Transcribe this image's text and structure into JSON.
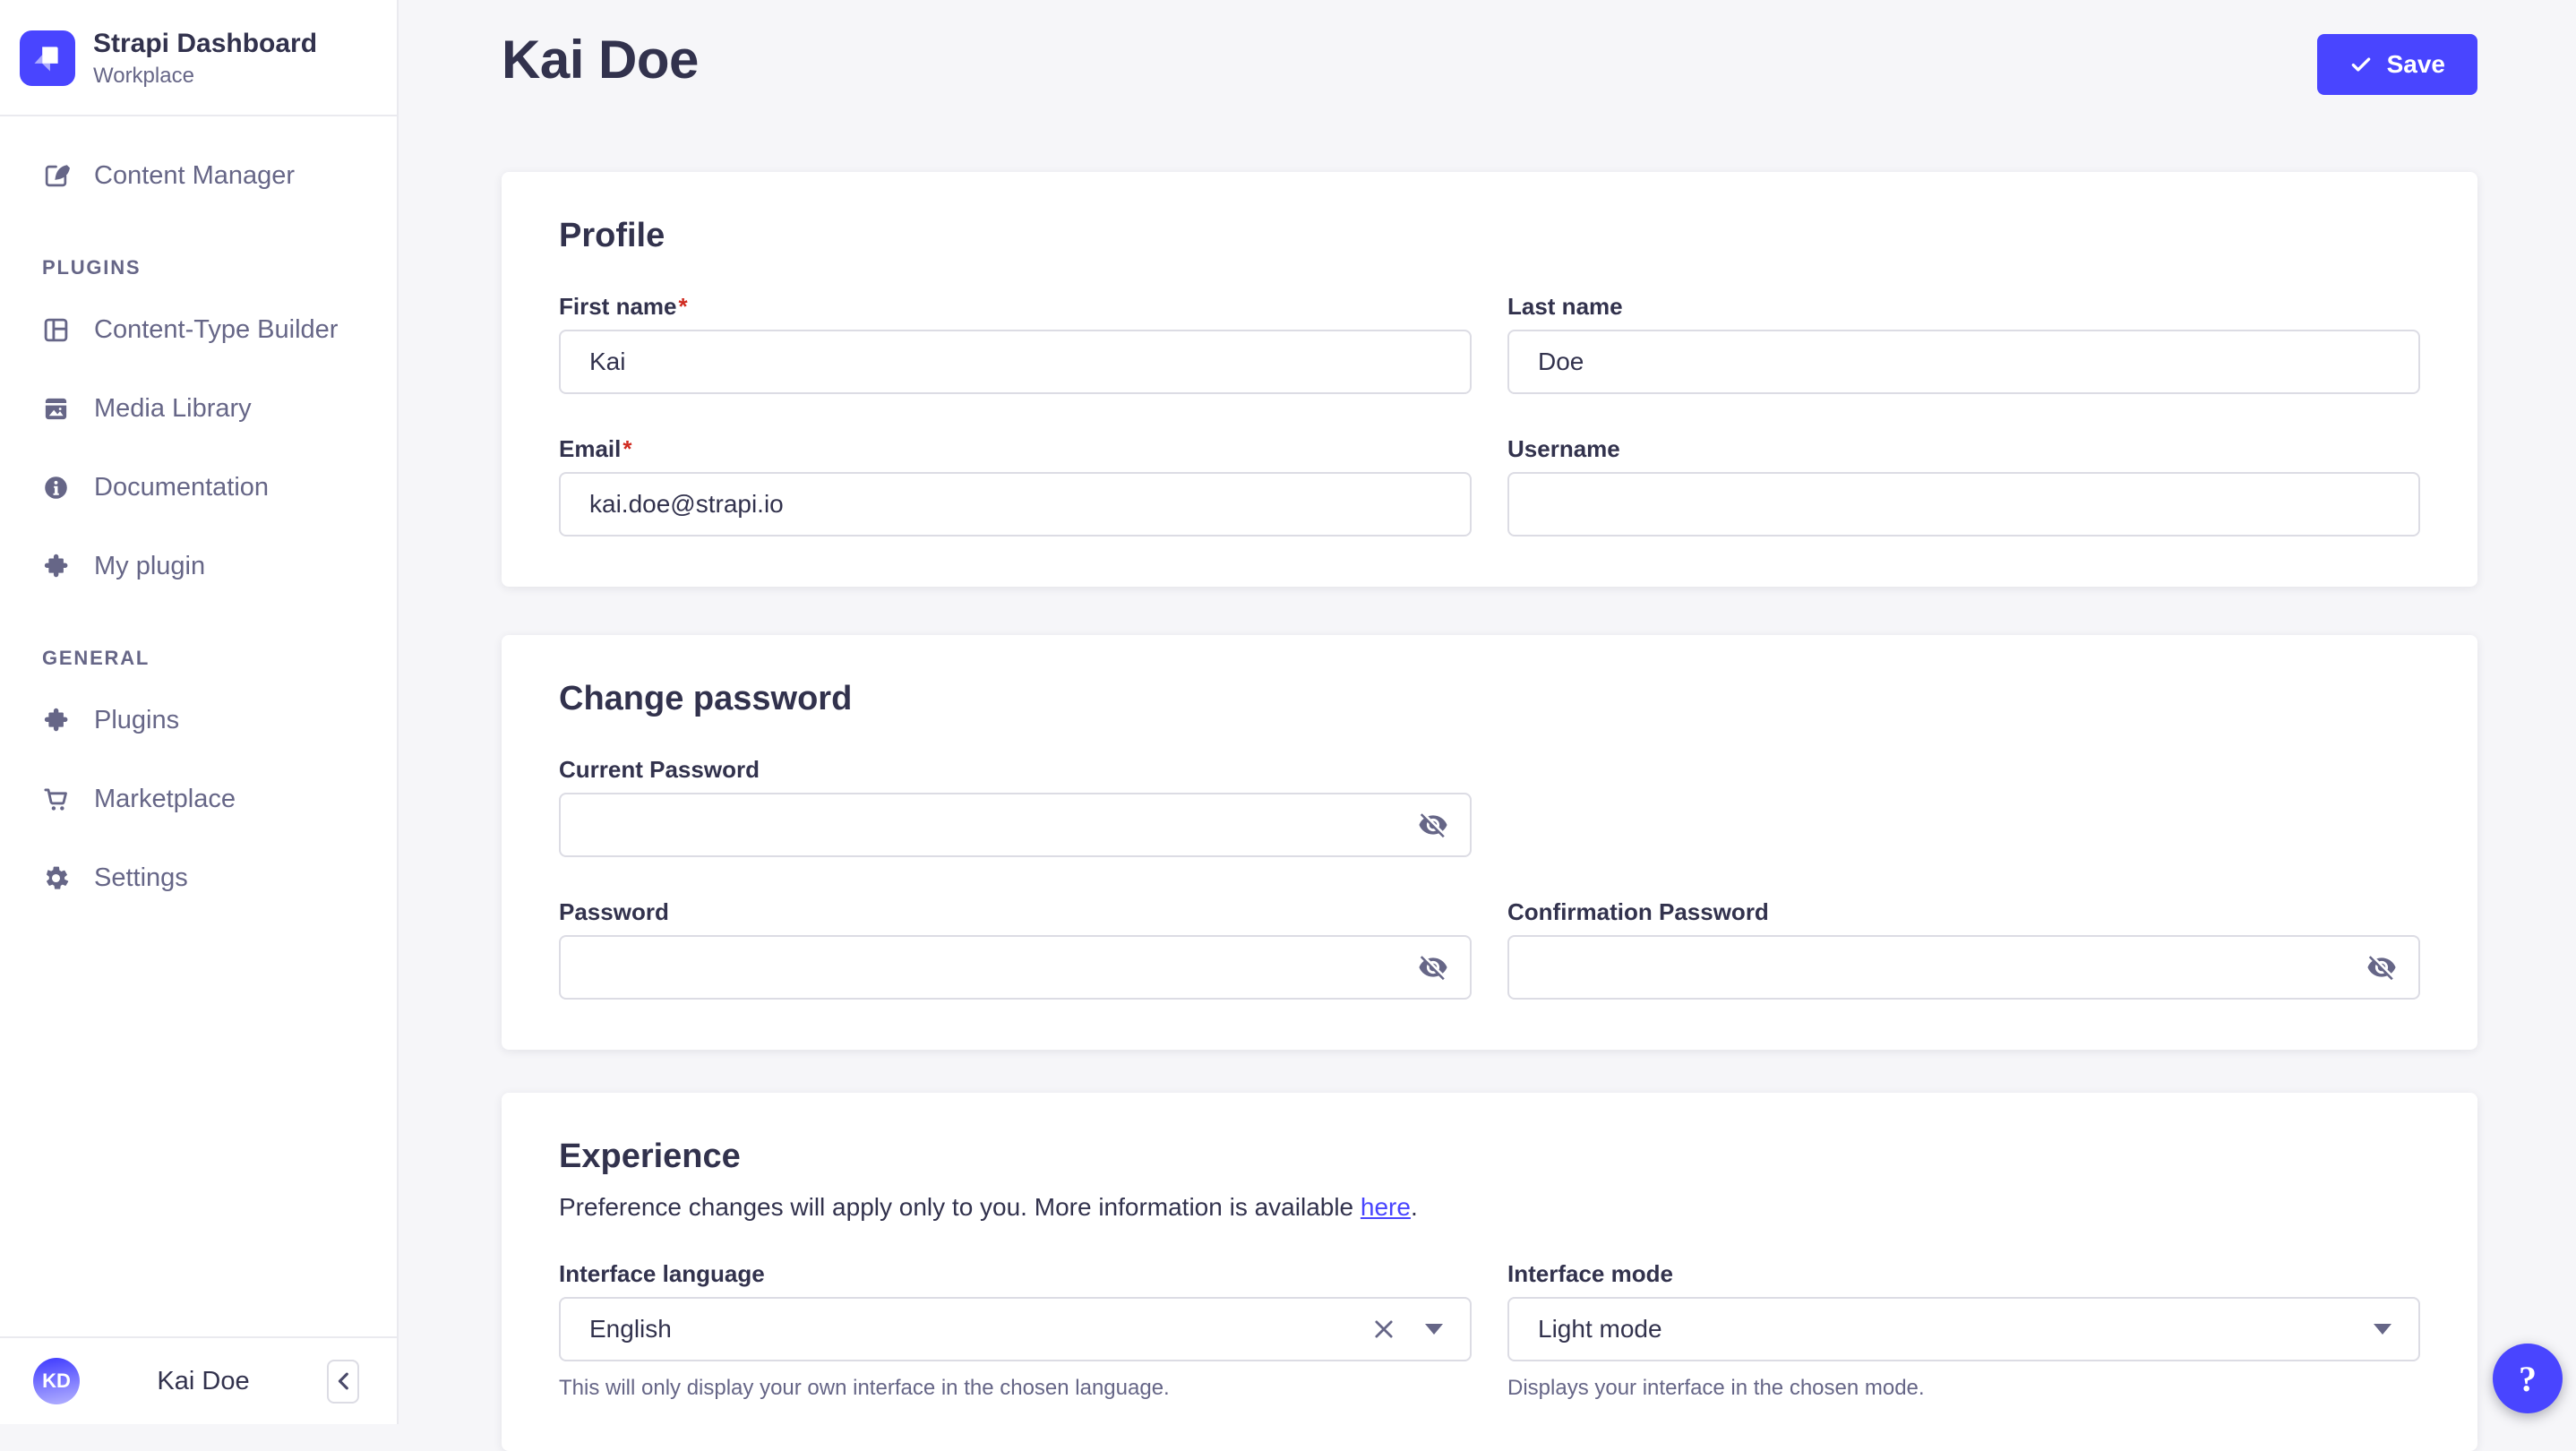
{
  "colors": {
    "accent": "#4945ff",
    "background": "#f6f6f9",
    "text_dark": "#32324d",
    "text_muted": "#666687",
    "border": "#dcdce4",
    "danger": "#d02b20"
  },
  "ui": {
    "required_marker": "*"
  },
  "app": {
    "title": "Strapi Dashboard",
    "subtitle": "Workplace"
  },
  "sidebar": {
    "main": [
      {
        "label": "Content Manager",
        "icon": "feather-icon"
      }
    ],
    "plugins_header": "PLUGINS",
    "plugins": [
      {
        "label": "Content-Type Builder",
        "icon": "layout-icon"
      },
      {
        "label": "Media Library",
        "icon": "picture-icon"
      },
      {
        "label": "Documentation",
        "icon": "info-circle-icon"
      },
      {
        "label": "My plugin",
        "icon": "puzzle-icon"
      }
    ],
    "general_header": "GENERAL",
    "general": [
      {
        "label": "Plugins",
        "icon": "puzzle-icon"
      },
      {
        "label": "Marketplace",
        "icon": "cart-icon"
      },
      {
        "label": "Settings",
        "icon": "gear-icon"
      }
    ],
    "user": {
      "initials": "KD",
      "name": "Kai Doe"
    }
  },
  "header": {
    "title": "Kai Doe",
    "save_button": "Save"
  },
  "sections": {
    "profile": {
      "title": "Profile",
      "first_name": {
        "label": "First name",
        "required": true,
        "value": "Kai"
      },
      "last_name": {
        "label": "Last name",
        "value": "Doe"
      },
      "email": {
        "label": "Email",
        "required": true,
        "value": "kai.doe@strapi.io"
      },
      "username": {
        "label": "Username",
        "value": ""
      }
    },
    "change_password": {
      "title": "Change password",
      "current_password": {
        "label": "Current Password",
        "value": ""
      },
      "password": {
        "label": "Password",
        "value": ""
      },
      "confirmation_password": {
        "label": "Confirmation Password",
        "value": ""
      }
    },
    "experience": {
      "title": "Experience",
      "description": "Preference changes will apply only to you. More information is available ",
      "description_link": "here",
      "description_suffix": ".",
      "interface_language": {
        "label": "Interface language",
        "value": "English",
        "hint": "This will only display your own interface in the chosen language."
      },
      "interface_mode": {
        "label": "Interface mode",
        "value": "Light mode",
        "hint": "Displays your interface in the chosen mode."
      }
    }
  },
  "help_button": "?"
}
